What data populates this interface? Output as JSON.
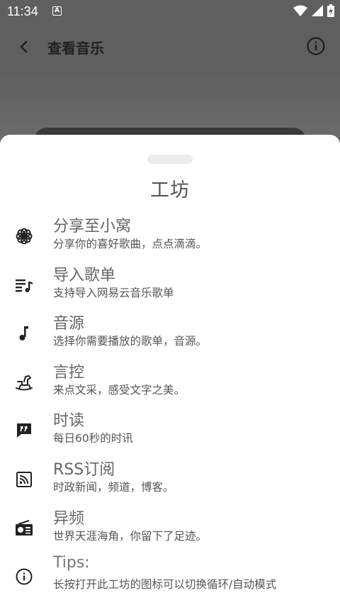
{
  "status_bar": {
    "time": "11:34",
    "notification_badge": "A",
    "icons": [
      "wifi-icon",
      "signal-icon",
      "battery-charging-icon"
    ]
  },
  "app_bar": {
    "title": "查看音乐",
    "back_icon": "arrow-back-icon",
    "info_icon": "info-icon"
  },
  "sheet": {
    "title": "工坊",
    "items": [
      {
        "icon": "flower-icon",
        "title": "分享至小窝",
        "subtitle": "分享你的喜好歌曲，点点滴滴。"
      },
      {
        "icon": "playlist-add-icon",
        "title": "导入歌单",
        "subtitle": "支持导入网易云音乐歌单"
      },
      {
        "icon": "music-note-icon",
        "title": "音源",
        "subtitle": "选择你需要播放的歌单，音源。"
      },
      {
        "icon": "rocking-horse-icon",
        "title": "言控",
        "subtitle": "来点文采，感受文字之美。"
      },
      {
        "icon": "quote-chat-icon",
        "title": "时读",
        "subtitle": "每日60秒的时讯"
      },
      {
        "icon": "rss-feed-icon",
        "title": "RSS订阅",
        "subtitle": "时政新闻，频道，博客。"
      },
      {
        "icon": "radio-icon",
        "title": "异频",
        "subtitle": "世界天涯海角，你留下了足迹。"
      },
      {
        "icon": "info-outline-icon",
        "title": "Tips:",
        "subtitle": "长按打开此工坊的图标可以切换循环/自动模式"
      }
    ]
  }
}
